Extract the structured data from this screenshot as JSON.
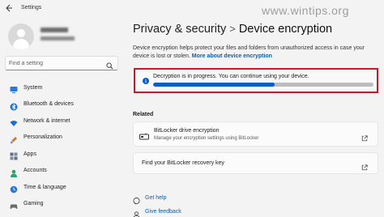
{
  "window": {
    "title": "Settings",
    "back_icon": "back-arrow-icon"
  },
  "profile": {
    "name": "",
    "email": ""
  },
  "search": {
    "placeholder": "Find a setting",
    "value": "",
    "icon": "search-icon"
  },
  "sidebar": {
    "items": [
      {
        "label": "System",
        "icon": "monitor-icon",
        "color": "#2b78d6"
      },
      {
        "label": "Bluetooth & devices",
        "icon": "bluetooth-icon",
        "color": "#1e70c9"
      },
      {
        "label": "Network & internet",
        "icon": "wifi-icon",
        "color": "#1a6fd0"
      },
      {
        "label": "Personalization",
        "icon": "brush-icon",
        "color": "#c77a2a"
      },
      {
        "label": "Apps",
        "icon": "apps-icon",
        "color": "#5f6f86"
      },
      {
        "label": "Accounts",
        "icon": "person-icon",
        "color": "#2fa36b"
      },
      {
        "label": "Time & language",
        "icon": "globe-clock-icon",
        "color": "#2b78d6"
      },
      {
        "label": "Gaming",
        "icon": "gamepad-icon",
        "color": "#6a6a6a"
      }
    ]
  },
  "main": {
    "breadcrumb_parent": "Privacy & security",
    "breadcrumb_sep": ">",
    "breadcrumb_current": "Device encryption",
    "description": "Device encryption helps protect your files and folders from unauthorized access in case your device is lost or stolen.",
    "description_link": "More about device encryption",
    "status": {
      "text": "Decryption is in progress. You can continue using your device.",
      "icon": "info-icon",
      "progress": 0.55,
      "color": "#0a5ec4"
    },
    "related_title": "Related",
    "related": [
      {
        "title": "BitLocker drive encryption",
        "subtitle": "Manage your encryption settings using BitLocker",
        "icon": "bitlocker-drive-icon"
      },
      {
        "title": "Find your BitLocker recovery key",
        "subtitle": ""
      }
    ],
    "help": [
      {
        "label": "Get help",
        "icon": "help-chat-icon"
      },
      {
        "label": "Give feedback",
        "icon": "feedback-icon"
      }
    ]
  },
  "watermark": "www.wintips.org",
  "colors": {
    "accent": "#0b5ea8",
    "highlight_border": "#c8182b"
  }
}
